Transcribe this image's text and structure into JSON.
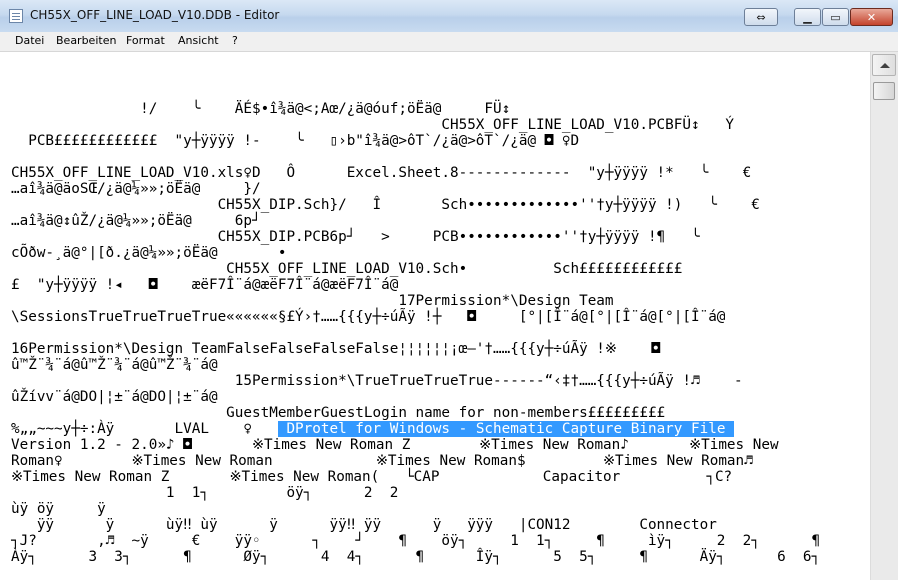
{
  "window": {
    "title": "CH55X_OFF_LINE_LOAD_V10.DDB - Editor"
  },
  "menu": {
    "items": [
      "Datei",
      "Bearbeiten",
      "Format",
      "Ansicht",
      "?"
    ]
  },
  "editor": {
    "lines": [
      "               !/    ╰    ÄÉ$•î¾ä@<;Aœ/¿ä@óuf;öËä@     FÜ↕",
      "                                                  CH55X_OFF_LINE_LOAD_V10.PCBFÜ↕   Ý",
      "  PCB££££££££££££  \"y┼ÿÿÿÿ !-    ╰   ▯›b\"î¾ä@>ôT`/¿ä@>ôT`/¿ä@ ◘ ♀D",
      "",
      "CH55X_OFF_LINE_LOAD_V10.xls♀D   Ô      Excel.Sheet.8-------------  \"y┼ÿÿÿÿ !*   ╰    €",
      "…aî¾ä@äoSŒ/¿ä@¼»»;öËä@     }/",
      "                        CH55X_DIP.Sch}/   Î       Sch•••••••••••••''†y┼ÿÿÿÿ !)   ╰    €",
      "…aî¾ä@↕ûŽ/¿ä@¼»»;öËä@     6p┘",
      "                        CH55X_DIP.PCB6p┘   >     PCB••••••••••••''†y┼ÿÿÿÿ !¶   ╰",
      "cÕðw-¸ä@°|[ð.¿ä@¼»»;öËä@       •",
      "                         CH55X_OFF_LINE_LOAD_V10.Sch•          Sch££££££££££££",
      "£  \"y┼ÿÿÿÿ !◂   ◘    æëF7Î¨á@æëF7Î¨á@æëF7Î¨á@",
      "                                             17Permission*\\Design Team",
      "\\SessionsTrueTrueTrueTrue««««««§£Ý›†……{{{y┼÷úÃÿ !┼   ◘     [°|[Î¨á@[°|[Î¨á@[°|[Î¨á@",
      "",
      "16Permission*\\Design TeamFalseFalseFalseFalse¦¦¦¦¦¦¡œ–'†……{{{y┼÷úÃÿ !※    ◘",
      "û™Ž¨¾¨á@û™Ž¨¾¨á@û™Ž¨¾¨á@",
      "                          15Permission*\\TrueTrueTrueTrue------“‹‡†……{{{y┼÷úÃÿ !♬    -",
      "ûŽívv¨á@DO|¦±¨á@DO|¦±¨á@",
      "                         GuestMemberGuestLogin name for non-members£££££££££",
      "%„„~~~y┼÷:Àÿ       LVAL    ♀   ",
      "Version 1.2 - 2.0»♪ ◘       ※Times New Roman Z        ※Times New Roman♪       ※Times New",
      "Roman♀        ※Times New Roman            ※Times New Roman$         ※Times New Roman♬",
      "※Times New Roman Z       ※Times New Roman(   └CAP            Capacitor          ┐C?",
      "                  1  1┐         öÿ┐      2  2",
      "ùÿ öÿ     ÿ",
      "   ÿÿ      ÿ      ùÿ‼ ùÿ      ÿ      ÿÿ‼ ÿÿ      ÿ   ÿÿÿ   |CON12        Connector",
      "┐J?       ‚♬  ~ÿ     €    ÿÿ◦      ┐    ┘    ¶    öÿ┐     1  1┐     ¶     ìÿ┐     2  2┐      ¶",
      "Àÿ┐      3  3┐      ¶      Øÿ┐      4  4┐      ¶      Îÿ┐      5  5┐     ¶      Äÿ┐      6  6┐"
    ],
    "selected_prefix": "%„„~~~y┼÷:Àÿ       LVAL    ♀   ",
    "selected_text": "DProtel for Windows - Schematic Capture Binary File"
  },
  "icons": {
    "app": "notepad-icon",
    "restore_extra": "restore-icon",
    "minimize": "minimize-icon",
    "maximize": "maximize-icon",
    "close": "close-icon"
  },
  "colors": {
    "selection": "#3399ff",
    "titlebar": "#c6d9ef",
    "close_button": "#c4432c"
  }
}
